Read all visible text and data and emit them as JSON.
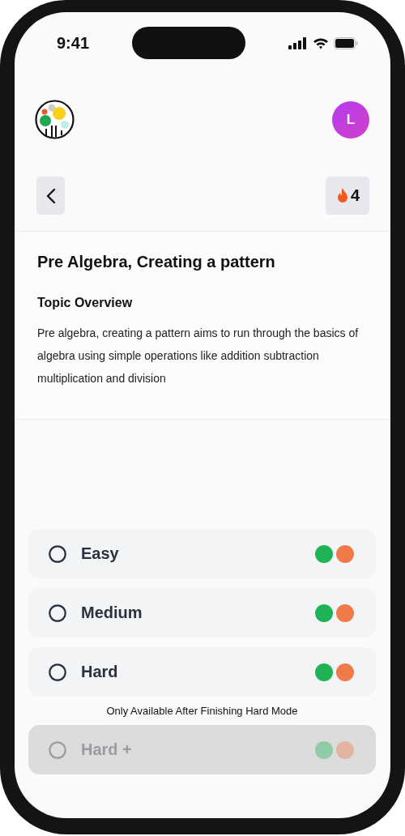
{
  "status_bar": {
    "time": "9:41"
  },
  "header": {
    "avatar_initial": "L"
  },
  "nav": {
    "streak": "4"
  },
  "topic": {
    "title": "Pre Algebra, Creating a pattern",
    "overview_heading": "Topic Overview",
    "overview": "Pre algebra, creating a pattern aims to run through the basics of algebra using simple operations like addition subtraction multiplication and division"
  },
  "options": [
    {
      "label": "Easy",
      "selected": false,
      "disabled": false
    },
    {
      "label": "Medium",
      "selected": false,
      "disabled": false
    },
    {
      "label": "Hard",
      "selected": false,
      "disabled": false
    },
    {
      "label": "Hard +",
      "selected": false,
      "disabled": true,
      "notice": "Only Available After Finishing Hard Mode"
    }
  ]
}
